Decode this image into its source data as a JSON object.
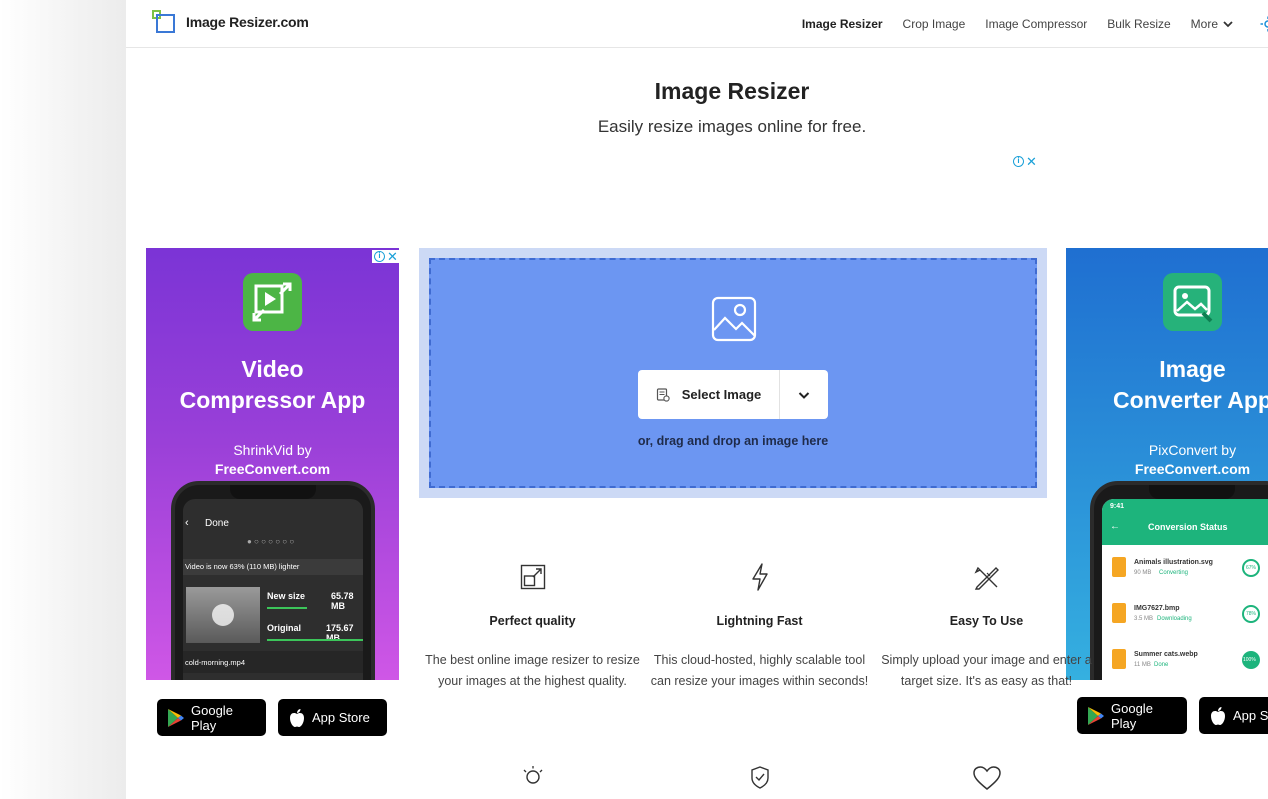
{
  "header": {
    "logo_text": "Image Resizer.com",
    "nav": [
      {
        "label": "Image Resizer",
        "active": true
      },
      {
        "label": "Crop Image",
        "active": false
      },
      {
        "label": "Image Compressor",
        "active": false
      },
      {
        "label": "Bulk Resize",
        "active": false
      }
    ],
    "more_label": "More"
  },
  "hero": {
    "title": "Image Resizer",
    "subtitle": "Easily resize images online for free."
  },
  "ad_left": {
    "headline_1": "Video",
    "headline_2": "Compressor App",
    "by_1": "ShrinkVid by",
    "by_2": "FreeConvert.com",
    "screen": {
      "back_label": "Done",
      "banner": "Video is now 63% (110 MB) lighter",
      "new_size_label": "New size",
      "new_size_value": "65.78 MB",
      "original_label": "Original",
      "original_value": "175.67 MB",
      "file_name": "cold-morning.mp4"
    },
    "store_google": "Google Play",
    "store_apple": "App Store"
  },
  "ad_right": {
    "headline_1": "Image",
    "headline_2": "Converter App",
    "by_1": "PixConvert by",
    "by_2": "FreeConvert.com",
    "screen": {
      "time": "9:41",
      "header": "Conversion Status",
      "files": [
        {
          "name": "Animals illustration.svg",
          "size": "90 MB",
          "status": "Converting",
          "pct": "67%"
        },
        {
          "name": "IMG7627.bmp",
          "size": "3.5 MB",
          "status": "Downloading",
          "pct": "78%"
        },
        {
          "name": "Summer cats.webp",
          "size": "11 MB",
          "status": "Done",
          "pct": "100%"
        }
      ]
    },
    "store_google": "Google Play",
    "store_apple": "App Store"
  },
  "upload": {
    "select_label": "Select Image",
    "drag_text": "or, drag and drop an image here"
  },
  "features": [
    {
      "name": "Perfect quality",
      "desc": "The best online image resizer to resize your images at the highest quality.",
      "icon": "resize-frame-icon"
    },
    {
      "name": "Lightning Fast",
      "desc": "This cloud-hosted, highly scalable tool can resize your images within seconds!",
      "icon": "lightning-icon"
    },
    {
      "name": "Easy To Use",
      "desc": "Simply upload your image and enter a target size. It's as easy as that!",
      "icon": "tools-icon"
    }
  ],
  "colors": {
    "upload_bg": "#6c96f2",
    "upload_border": "#3f6bd1",
    "ad_left_top": "#7b34d6",
    "ad_right_top": "#1f6fd1"
  }
}
